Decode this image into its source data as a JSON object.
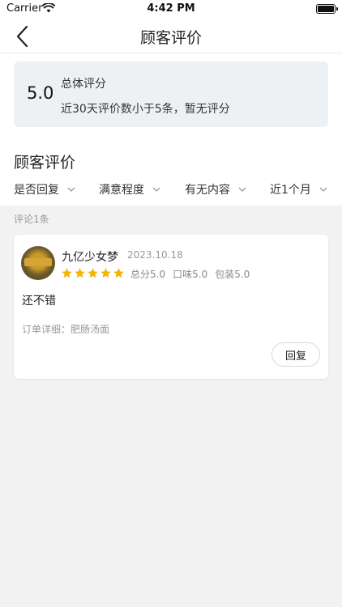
{
  "status_bar": {
    "carrier": "Carrier",
    "time": "4:42 PM"
  },
  "navbar": {
    "title": "顾客评价"
  },
  "summary": {
    "score": "5.0",
    "title": "总体评分",
    "note": "近30天评价数小于5条，暂无评分"
  },
  "section_title": "顾客评价",
  "filters": [
    {
      "label": "是否回复"
    },
    {
      "label": "满意程度"
    },
    {
      "label": "有无内容"
    },
    {
      "label": "近1个月"
    }
  ],
  "review_count_label": "评论1条",
  "review": {
    "reviewer_name": "九亿少女梦",
    "date": "2023.10.18",
    "rating": 5,
    "rating_max": 5,
    "star_color": "#f5b400",
    "sub_scores": [
      "总分5.0",
      "口味5.0",
      "包装5.0"
    ],
    "content": "还不错",
    "order_detail": "订单详细：肥肠汤面",
    "reply_label": "回复"
  }
}
